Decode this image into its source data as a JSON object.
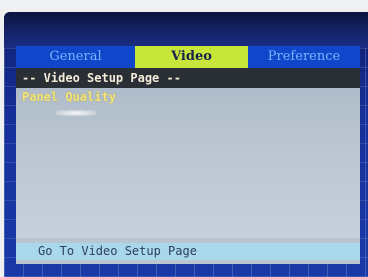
{
  "tabs": [
    {
      "label": "General"
    },
    {
      "label": "Video"
    },
    {
      "label": "Preference"
    }
  ],
  "heading": "-- Video Setup Page --",
  "items": [
    {
      "label": "Panel Quality"
    }
  ],
  "status": "Go To Video Setup Page",
  "colors": {
    "active_tab": "#c8e63a",
    "inactive_tab": "#1046c9",
    "heading_bar": "#2a2f36",
    "item_text": "#f4e67a",
    "status_bar": "#a9d8ea"
  }
}
